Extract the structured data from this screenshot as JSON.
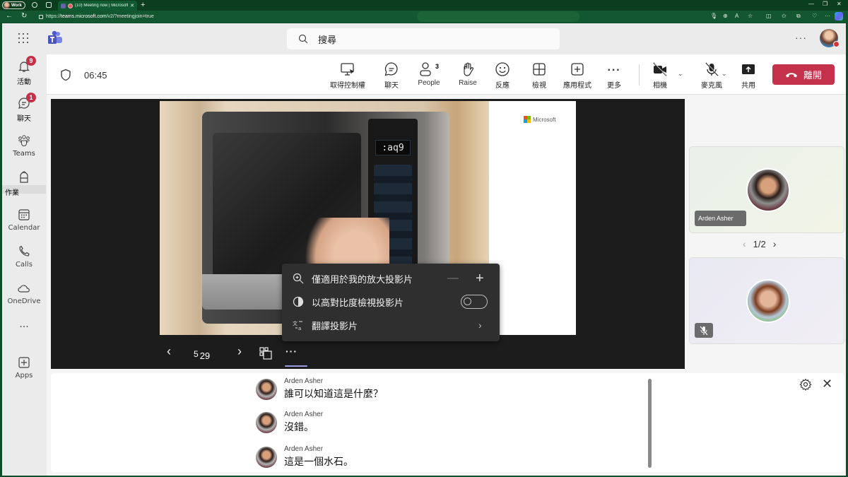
{
  "browser": {
    "profile_label": "Work",
    "tab_title": "(10) Meeting now | Microsoft",
    "url_prefix": "https://",
    "url_domain": "teams.microsoft.com",
    "url_path": "/v2/?meetingjoin=true",
    "new_tab": "+",
    "close_tab": "✕",
    "minimize": "—",
    "restore": "❐",
    "close_window": "✕",
    "back": "←",
    "refresh": "↻",
    "more": "···",
    "toolbar_icons": [
      "mic-icon",
      "zoom-icon",
      "read-aloud-icon",
      "favorite-icon",
      "split-screen-icon",
      "favorites-icon",
      "collections-icon",
      "extensions-icon",
      "more-icon",
      "copilot-icon"
    ]
  },
  "app": {
    "search_label": "搜尋",
    "more": "···",
    "rail": [
      {
        "label": "活動",
        "icon": "bell-icon",
        "badge": "9"
      },
      {
        "label": "聊天",
        "icon": "chat-icon",
        "badge": "1"
      },
      {
        "label": "Teams",
        "icon": "teams-icon"
      },
      {
        "label": "作業",
        "icon": "backpack-icon",
        "active": true
      },
      {
        "label": "Calendar",
        "icon": "calendar-icon"
      },
      {
        "label": "Calls",
        "icon": "phone-icon"
      },
      {
        "label": "OneDrive",
        "icon": "cloud-icon"
      },
      {
        "label": "···",
        "icon": "more-apps-icon"
      },
      {
        "label": "Apps",
        "icon": "apps-icon"
      }
    ]
  },
  "meeting": {
    "timer": "06:45",
    "controls": {
      "take_control": "取得控制權",
      "chat": "聊天",
      "people": "People",
      "people_count": "3",
      "raise": "Raise",
      "react": "反應",
      "view": "檢視",
      "apps": "應用程式",
      "more": "更多",
      "more_glyph": "···",
      "camera": "相機",
      "mic": "麥克風",
      "share": "共用",
      "leave": "離開",
      "caret": "⌄"
    },
    "slide": {
      "display_text": ":aq9",
      "brand": "Microsoft",
      "brand_colors": [
        "#f25022",
        "#7fba00",
        "#00a4ef",
        "#ffb900"
      ]
    },
    "slide_menu": {
      "zoom_label": "僅適用於我的放大投影片",
      "zoom_minus": "—",
      "zoom_plus": "+",
      "contrast_label": "以高對比度檢視投影片",
      "contrast_on": false,
      "translate_label": "翻譯投影片",
      "chevron": "›"
    },
    "slide_nav": {
      "prev": "‹",
      "next": "›",
      "current": "5",
      "total": "29",
      "more": "···"
    },
    "participants": {
      "tile1_name": "Arden Asher",
      "pager": "1/2",
      "pager_prev": "‹",
      "pager_next": "›"
    },
    "captions": {
      "close": "✕",
      "messages": [
        {
          "speaker": "Arden Asher",
          "text": "誰可以知道這是什麼？"
        },
        {
          "speaker": "Arden Asher",
          "text": "沒錯。"
        },
        {
          "speaker": "Arden Asher",
          "text": "這是一個水石。"
        }
      ]
    },
    "accent": {
      "leave_red": "#c4314b",
      "badge_red": "#c4314b",
      "brand_purple": "#6264a7"
    }
  }
}
